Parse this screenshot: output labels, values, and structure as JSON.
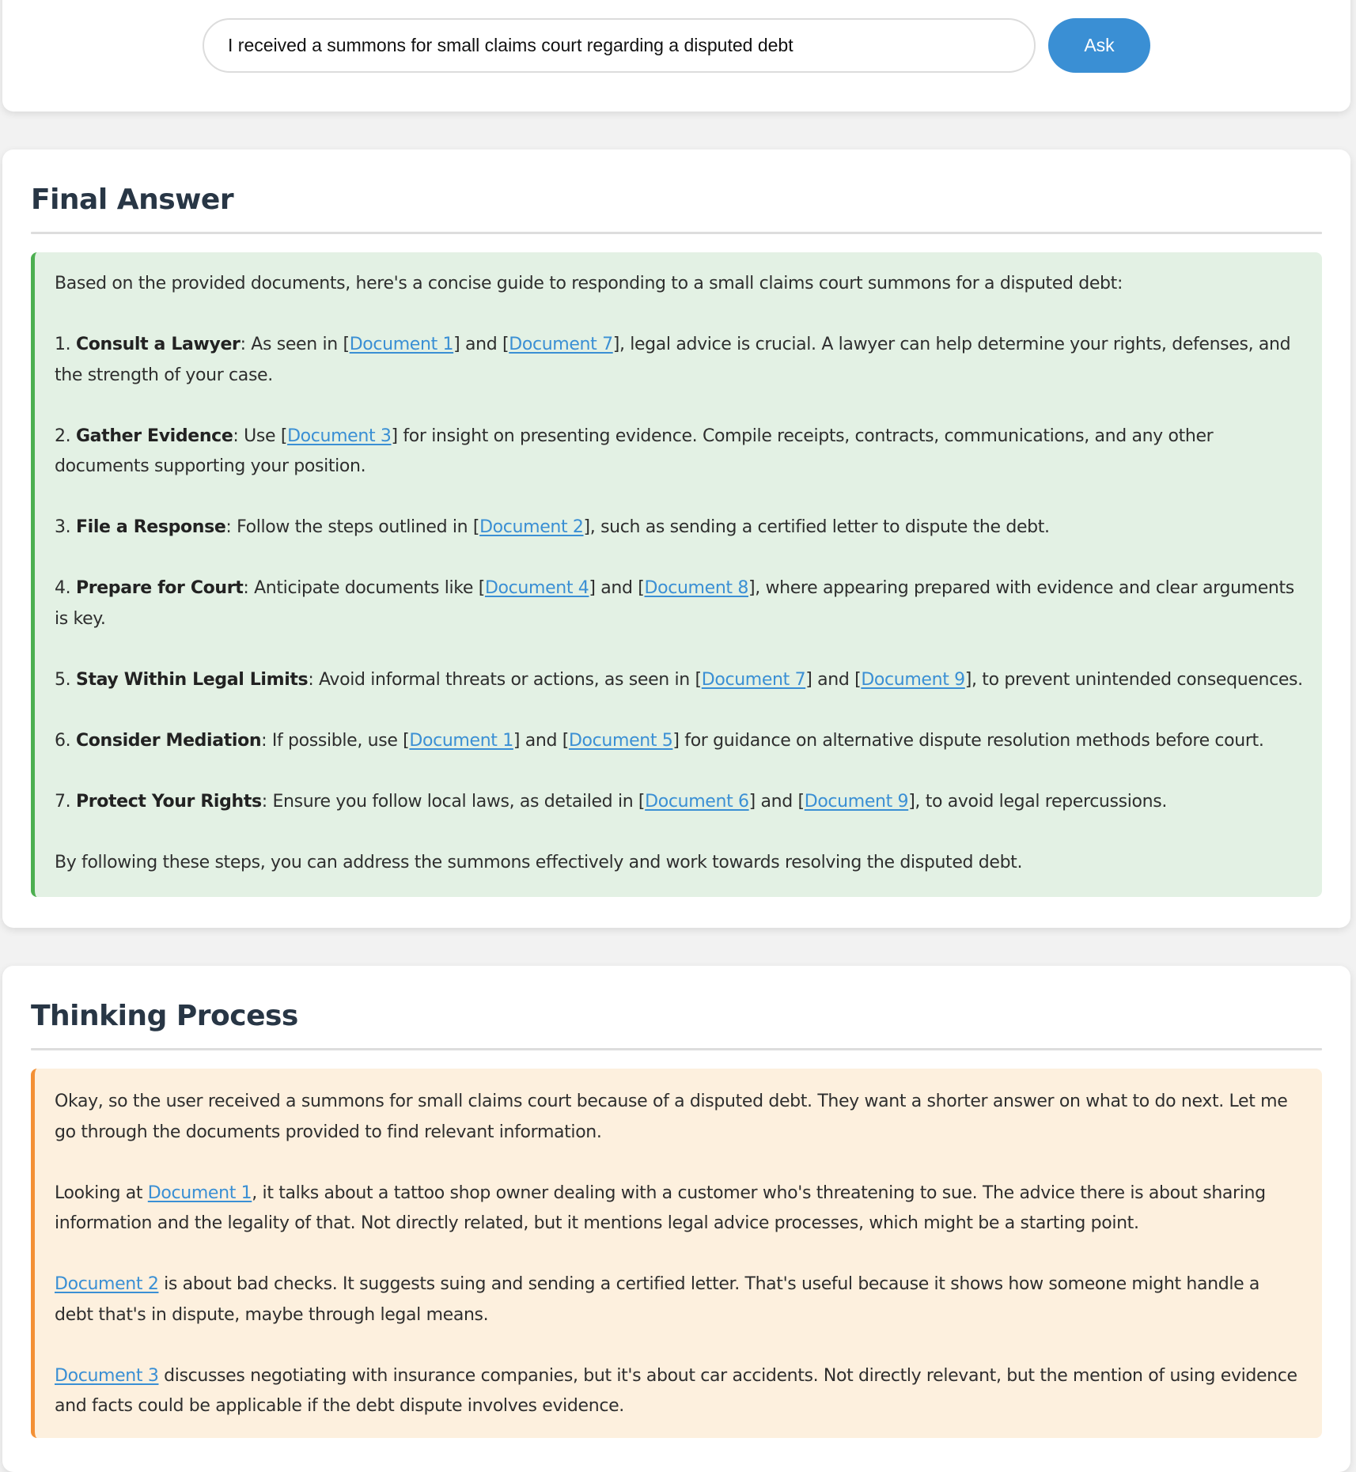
{
  "search": {
    "query_value": "I received a summons for small claims court regarding a disputed debt",
    "ask_label": "Ask"
  },
  "colors": {
    "accent": "#3a8fd4",
    "answer_border": "#4caf50",
    "answer_bg": "#e3f1e4",
    "thinking_border": "#f39035",
    "thinking_bg": "#fdf0de",
    "heading": "#283645"
  },
  "final_answer": {
    "title": "Final Answer",
    "intro": "Based on the provided documents, here's a concise guide to responding to a small claims court summons for a disputed debt:",
    "steps": [
      {
        "num": "1.",
        "title": "Consult a Lawyer",
        "t0": ": As seen in [",
        "d0": "Document 1",
        "t1": "] and [",
        "d1": "Document 7",
        "t2": "], legal advice is crucial. A lawyer can help determine your rights, defenses, and the strength of your case."
      },
      {
        "num": "2.",
        "title": "Gather Evidence",
        "t0": ": Use [",
        "d0": "Document 3",
        "t1": "] for insight on presenting evidence. Compile receipts, contracts, communications, and any other documents supporting your position."
      },
      {
        "num": "3.",
        "title": "File a Response",
        "t0": ": Follow the steps outlined in [",
        "d0": "Document 2",
        "t1": "], such as sending a certified letter to dispute the debt."
      },
      {
        "num": "4.",
        "title": "Prepare for Court",
        "t0": ": Anticipate documents like [",
        "d0": "Document 4",
        "t1": "] and [",
        "d1": "Document 8",
        "t2": "], where appearing prepared with evidence and clear arguments is key."
      },
      {
        "num": "5.",
        "title": "Stay Within Legal Limits",
        "t0": ": Avoid informal threats or actions, as seen in [",
        "d0": "Document 7",
        "t1": "] and [",
        "d1": "Document 9",
        "t2": "], to prevent unintended consequences."
      },
      {
        "num": "6.",
        "title": "Consider Mediation",
        "t0": ": If possible, use [",
        "d0": "Document 1",
        "t1": "] and [",
        "d1": "Document 5",
        "t2": "] for guidance on alternative dispute resolution methods before court."
      },
      {
        "num": "7.",
        "title": "Protect Your Rights",
        "t0": ": Ensure you follow local laws, as detailed in [",
        "d0": "Document 6",
        "t1": "] and [",
        "d1": "Document 9",
        "t2": "], to avoid legal repercussions."
      }
    ],
    "conclusion": "By following these steps, you can address the summons effectively and work towards resolving the disputed debt."
  },
  "thinking": {
    "title": "Thinking Process",
    "p0": "Okay, so the user received a summons for small claims court because of a disputed debt. They want a shorter answer on what to do next. Let me go through the documents provided to find relevant information.",
    "p1": {
      "t0": "Looking at ",
      "d0": "Document 1",
      "t1": ", it talks about a tattoo shop owner dealing with a customer who's threatening to sue. The advice there is about sharing information and the legality of that. Not directly related, but it mentions legal advice processes, which might be a starting point."
    },
    "p2": {
      "d0": "Document 2",
      "t1": " is about bad checks. It suggests suing and sending a certified letter. That's useful because it shows how someone might handle a debt that's in dispute, maybe through legal means."
    },
    "p3": {
      "d0": "Document 3",
      "t1": " discusses negotiating with insurance companies, but it's about car accidents. Not directly relevant, but the mention of using evidence and facts could be applicable if the debt dispute involves evidence."
    }
  }
}
